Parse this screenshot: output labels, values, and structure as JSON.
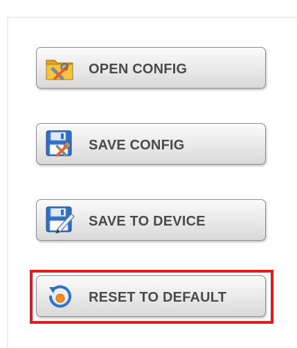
{
  "buttons": {
    "open_config": {
      "label": "OPEN CONFIG",
      "icon": "folder-tools-icon"
    },
    "save_config": {
      "label": "SAVE CONFIG",
      "icon": "save-config-icon"
    },
    "save_to_device": {
      "label": "SAVE TO DEVICE",
      "icon": "save-device-icon"
    },
    "reset_to_default": {
      "label": "RESET TO DEFAULT",
      "icon": "reset-icon"
    }
  },
  "colors": {
    "highlight": "#e31b1b",
    "label_text": "#4a4a4a",
    "button_border": "#8c8c8c"
  }
}
